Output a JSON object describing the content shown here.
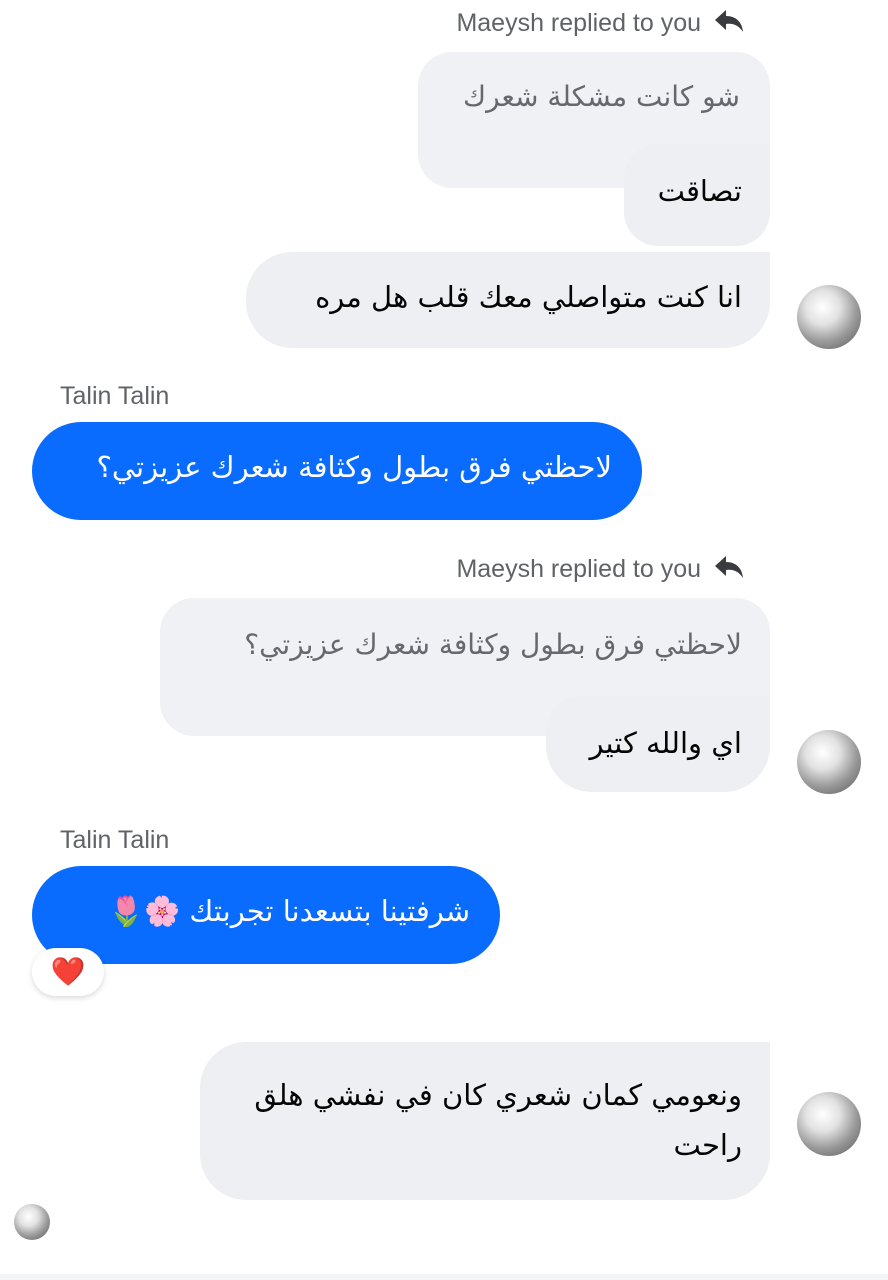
{
  "messages": [
    {
      "reply_label": "Maeysh replied to you",
      "quoted": "شو كانت مشكلة شعرك",
      "text": "تصاقت"
    },
    {
      "text": "انا كنت متواصلي معك قلب هل مره"
    },
    {
      "sender": "Talin Talin",
      "text": "لاحظتي فرق بطول وكثافة شعرك عزيزتي؟"
    },
    {
      "reply_label": "Maeysh replied to you",
      "quoted": "لاحظتي فرق بطول وكثافة شعرك عزيزتي؟",
      "text": "اي والله كتير"
    },
    {
      "sender": "Talin Talin",
      "text": "شرفتينا بتسعدنا تجربتك 🌸🌷",
      "reaction": "❤️"
    },
    {
      "text_line1": "ونعومي كمان شعري كان في نفشي هلق",
      "text_line2": "راحت"
    }
  ],
  "icons": {
    "reply": "reply-arrow-icon",
    "avatar": "contact-avatar"
  },
  "colors": {
    "outgoing_bubble": "#0a6cff",
    "incoming_bubble": "#eeeff3",
    "quoted_bubble": "#f0f1f4"
  }
}
